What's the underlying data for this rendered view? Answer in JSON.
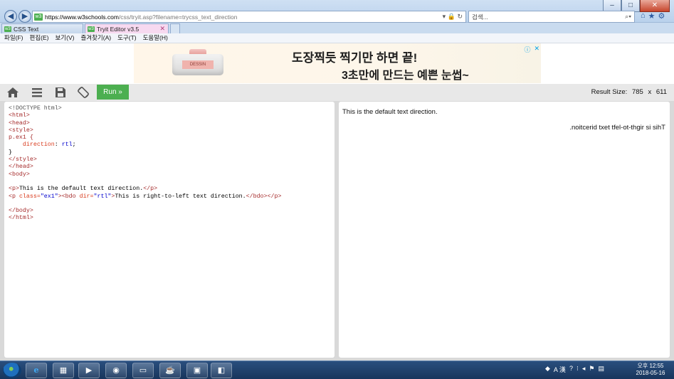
{
  "browser": {
    "url_host": "https://www.w3schools.com",
    "url_path": "/css/tryit.asp?filename=trycss_text_direction",
    "search_placeholder": "검색...",
    "tabs": [
      {
        "label": "CSS Text"
      },
      {
        "label": "Tryit Editor v3.5"
      }
    ],
    "menu": [
      "파일(F)",
      "편집(E)",
      "보기(V)",
      "즐겨찾기(A)",
      "도구(T)",
      "도움말(H)"
    ]
  },
  "ad": {
    "product_label": "DESSIN",
    "line1": "도장찍듯 찍기만 하면 끝!",
    "line2": "3초만에 만드는 예쁜 눈썹~"
  },
  "toolbar": {
    "run_label": "Run »",
    "result_size_label": "Result Size:",
    "result_width": "785",
    "result_sep": "x",
    "result_height": "611"
  },
  "code": [
    [
      {
        "t": "doctype",
        "s": "<!DOCTYPE html>"
      }
    ],
    [
      {
        "t": "tag",
        "s": "<html>"
      }
    ],
    [
      {
        "t": "tag",
        "s": "<head>"
      }
    ],
    [
      {
        "t": "tag",
        "s": "<style>"
      }
    ],
    [
      {
        "t": "sel",
        "s": "p.ex1 {"
      }
    ],
    [
      {
        "t": "text",
        "s": "    "
      },
      {
        "t": "prop",
        "s": "direction"
      },
      {
        "t": "text",
        "s": ": "
      },
      {
        "t": "val",
        "s": "rtl"
      },
      {
        "t": "text",
        "s": ";"
      }
    ],
    [
      {
        "t": "text",
        "s": "}"
      }
    ],
    [
      {
        "t": "tag",
        "s": "</style>"
      }
    ],
    [
      {
        "t": "tag",
        "s": "</head>"
      }
    ],
    [
      {
        "t": "tag",
        "s": "<body>"
      }
    ],
    [],
    [
      {
        "t": "tag",
        "s": "<p>"
      },
      {
        "t": "text",
        "s": "This is the default text direction."
      },
      {
        "t": "tag",
        "s": "</p>"
      }
    ],
    [
      {
        "t": "tag",
        "s": "<p "
      },
      {
        "t": "attr",
        "s": "class="
      },
      {
        "t": "val",
        "s": "\"ex1\""
      },
      {
        "t": "tag",
        "s": "><bdo "
      },
      {
        "t": "attr",
        "s": "dir="
      },
      {
        "t": "val",
        "s": "\"rtl\""
      },
      {
        "t": "tag",
        "s": ">"
      },
      {
        "t": "text",
        "s": "This is right-to-left text direction."
      },
      {
        "t": "tag",
        "s": "</bdo></p>"
      }
    ],
    [],
    [
      {
        "t": "tag",
        "s": "</body>"
      }
    ],
    [
      {
        "t": "tag",
        "s": "</html>"
      }
    ]
  ],
  "result": {
    "line1": "This is the default text direction.",
    "line2": "This is right-to-left text direction."
  },
  "taskbar": {
    "clock_time": "오후 12:55",
    "clock_date": "2018-05-16",
    "ime_label": "A 漢"
  }
}
